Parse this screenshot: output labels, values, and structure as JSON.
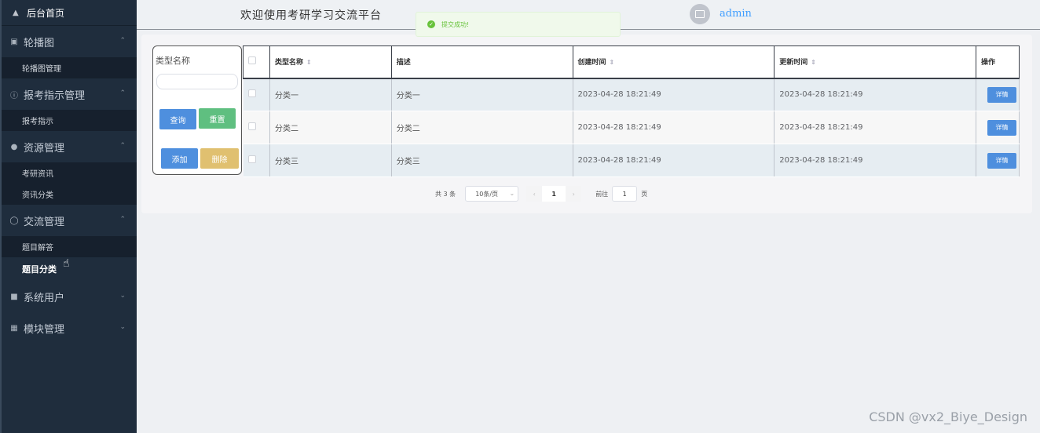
{
  "sidebar": {
    "home": "后台首页",
    "groups": [
      {
        "label": "轮播图",
        "icon": "image-icon",
        "items": [
          "轮播图管理"
        ]
      },
      {
        "label": "报考指示管理",
        "icon": "info-circle-icon",
        "items": [
          "报考指示"
        ]
      },
      {
        "label": "资源管理",
        "icon": "location-pin-icon",
        "items": [
          "考研资讯",
          "资讯分类"
        ]
      },
      {
        "label": "交流管理",
        "icon": "chat-icon",
        "items": [
          "题目解答",
          "题目分类"
        ]
      },
      {
        "label": "系统用户",
        "icon": "user-icon",
        "items": []
      },
      {
        "label": "模块管理",
        "icon": "grid-icon",
        "items": []
      }
    ]
  },
  "header": {
    "title": "欢迎使用考研学习交流平台",
    "username": "admin"
  },
  "toast": {
    "message": "提交成功!"
  },
  "search": {
    "label": "类型名称",
    "query": "查询",
    "reset": "重置",
    "add": "添加",
    "delete": "删除"
  },
  "table": {
    "headers": {
      "name": "类型名称",
      "desc": "描述",
      "created": "创建时间",
      "updated": "更新时间",
      "ops": "操作"
    },
    "detail_label": "详情",
    "rows": [
      {
        "name": "分类一",
        "desc": "分类一",
        "created": "2023-04-28 18:21:49",
        "updated": "2023-04-28 18:21:49"
      },
      {
        "name": "分类二",
        "desc": "分类二",
        "created": "2023-04-28 18:21:49",
        "updated": "2023-04-28 18:21:49"
      },
      {
        "name": "分类三",
        "desc": "分类三",
        "created": "2023-04-28 18:21:49",
        "updated": "2023-04-28 18:21:49"
      }
    ]
  },
  "pager": {
    "total": "共 3 条",
    "page_size": "10条/页",
    "current": "1",
    "goto": "前往",
    "goto_value": "1",
    "page_unit": "页"
  },
  "watermark": "CSDN @vx2_Biye_Design"
}
